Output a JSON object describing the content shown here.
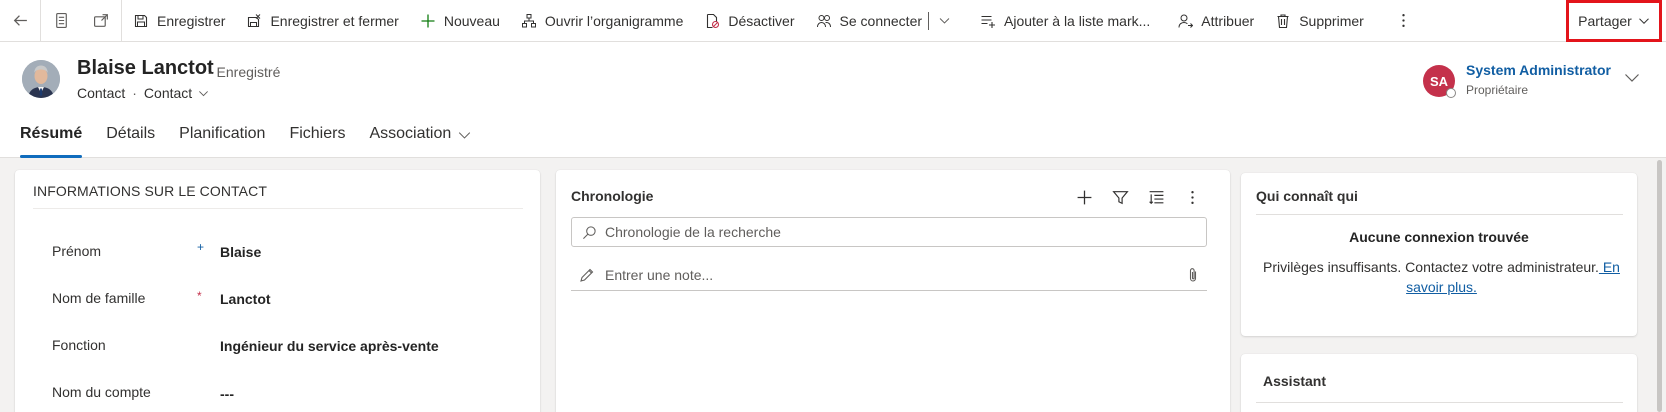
{
  "toolbar": {
    "save": "Enregistrer",
    "save_close": "Enregistrer et fermer",
    "new": "Nouveau",
    "org_chart": "Ouvrir l’organigramme",
    "deactivate": "Désactiver",
    "connect": "Se connecter",
    "add_marketing_list": "Ajouter à la liste mark...",
    "assign": "Attribuer",
    "delete": "Supprimer",
    "share": "Partager"
  },
  "record": {
    "name": "Blaise Lanctot",
    "status": "- Enregistré",
    "entity": "Contact",
    "form": "Contact"
  },
  "owner": {
    "initials": "SA",
    "name": "System Administrator",
    "role": "Propriétaire",
    "avatar_color": "#c4314b"
  },
  "tabs": [
    "Résumé",
    "Détails",
    "Planification",
    "Fichiers",
    "Association"
  ],
  "contact_info": {
    "title": "INFORMATIONS SUR LE CONTACT",
    "fields": [
      {
        "label": "Prénom",
        "req": "+",
        "value": "Blaise"
      },
      {
        "label": "Nom de famille",
        "req": "*",
        "value": "Lanctot"
      },
      {
        "label": "Fonction",
        "req": "",
        "value": "Ingénieur du service après-vente"
      },
      {
        "label": "Nom du compte",
        "req": "",
        "value": "---"
      }
    ]
  },
  "timeline": {
    "title": "Chronologie",
    "search_placeholder": "Chronologie de la recherche",
    "note_placeholder": "Entrer une note..."
  },
  "who_knows": {
    "title": "Qui connaît qui",
    "heading": "Aucune connexion trouvée",
    "message": "Privilèges insuffisants. Contactez votre administrateur.",
    "link": " En savoir plus."
  },
  "assistant": {
    "title": "Assistant"
  },
  "colors": {
    "accent": "#0f6cbd",
    "link": "#115ea3",
    "highlight": "#e3141b"
  }
}
